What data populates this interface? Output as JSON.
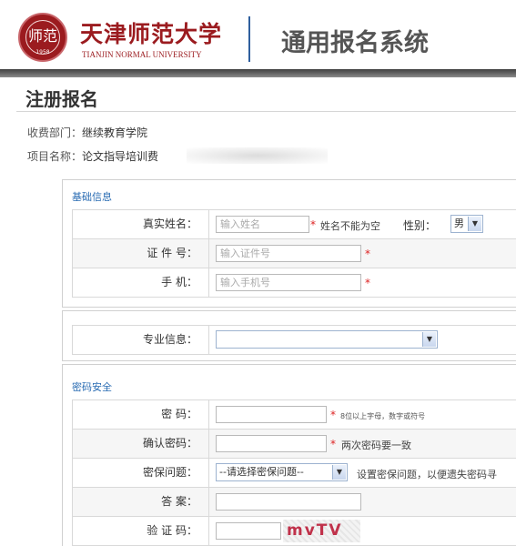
{
  "header": {
    "logo_glyph": "师范",
    "logo_year": "1958",
    "school_cn": "天津师范大学",
    "school_en": "TIANJIN NORMAL UNIVERSITY",
    "system_title": "通用报名系统",
    "brand_color": "#9b1b1f"
  },
  "page": {
    "title": "注册报名",
    "department_label": "收费部门：",
    "department_value": "继续教育学院",
    "project_label": "项目名称：",
    "project_value": "论文指导培训费"
  },
  "basic": {
    "section_title": "基础信息",
    "name_label": "真实姓名：",
    "name_placeholder": "输入姓名",
    "name_required": "*",
    "name_hint": "姓名不能为空",
    "gender_label": "性别：",
    "gender_value": "男",
    "id_label": "证 件 号：",
    "id_placeholder": "输入证件号",
    "id_required": "*",
    "phone_label": "手    机：",
    "phone_placeholder": "输入手机号",
    "phone_required": "*"
  },
  "major": {
    "label": "专业信息：",
    "selected": ""
  },
  "security": {
    "section_title": "密码安全",
    "password_label": "密    码：",
    "password_required": "*",
    "password_hint": "8位以上字母，数字或符号",
    "confirm_label": "确认密码：",
    "confirm_required": "*",
    "confirm_hint": "两次密码要一致",
    "question_label": "密保问题：",
    "question_selected": "--请选择密保问题--",
    "question_hint": "设置密保问题，以便遗失密码寻",
    "answer_label": "答    案：",
    "captcha_label": "验 证 码：",
    "captcha_text": "mvTV"
  }
}
